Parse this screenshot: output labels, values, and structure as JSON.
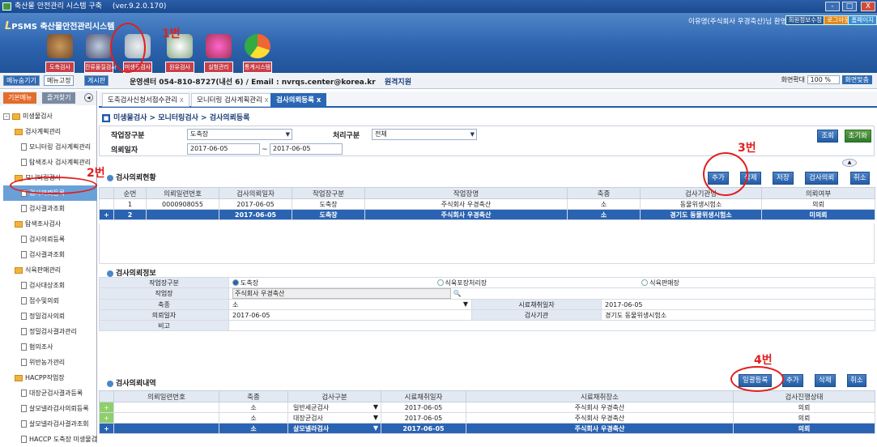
{
  "window": {
    "title": "축산물 안전관리 시스템 구축",
    "version": "(ver.9.2.0.170)",
    "min": "-",
    "max": "□",
    "close": "X"
  },
  "header": {
    "logo_prefix": "L",
    "logo_brand": "PSMS",
    "logo_text": "축산물안전관리시스템",
    "nav": [
      {
        "label": "도축검사"
      },
      {
        "label": "잔류물질검사"
      },
      {
        "label": "미생물검사"
      },
      {
        "label": "원유검사"
      },
      {
        "label": "실험관리"
      },
      {
        "label": "통계시스템"
      }
    ],
    "user_greeting": "이유명(주식회사 우경축산)님 환영합니다",
    "top_buttons": [
      "회원정보수정",
      "로그아웃",
      "홈페이지"
    ]
  },
  "toolbar": {
    "menu_toggle": "메뉴숨기기",
    "menu_fix": "메뉴고정",
    "board": "게시판",
    "contact": "운영센터 054-810-8727(내선 6) / Email : nvrqs.center@korea.kr",
    "remote": "원격지원",
    "zoom_label": "화면확대",
    "zoom_value": "100 %",
    "zoom_button": "화면맞춤"
  },
  "sidebar": {
    "tabs": [
      "기본메뉴",
      "즐겨찾기"
    ],
    "tree": [
      {
        "level": 1,
        "label": "미생물검사",
        "kind": "folder"
      },
      {
        "level": 2,
        "label": "검사계획관리",
        "kind": "folder"
      },
      {
        "level": 3,
        "label": "모니터링 검사계획관리",
        "kind": "doc"
      },
      {
        "level": 3,
        "label": "탐색조사 검사계획관리",
        "kind": "doc"
      },
      {
        "level": 2,
        "label": "모니터링검사",
        "kind": "folder"
      },
      {
        "level": 3,
        "label": "검사의뢰등록",
        "kind": "doc",
        "selected": true
      },
      {
        "level": 3,
        "label": "검사결과조회",
        "kind": "doc"
      },
      {
        "level": 2,
        "label": "탐색조사검사",
        "kind": "folder"
      },
      {
        "level": 3,
        "label": "검사의뢰등록",
        "kind": "doc"
      },
      {
        "level": 3,
        "label": "검사결과조회",
        "kind": "doc"
      },
      {
        "level": 2,
        "label": "식육판매관리",
        "kind": "folder"
      },
      {
        "level": 3,
        "label": "검사대상조회",
        "kind": "doc"
      },
      {
        "level": 3,
        "label": "접수및의뢰",
        "kind": "doc"
      },
      {
        "level": 3,
        "label": "정밀검사의뢰",
        "kind": "doc"
      },
      {
        "level": 3,
        "label": "정밀검사결과관리",
        "kind": "doc"
      },
      {
        "level": 3,
        "label": "혐의조사",
        "kind": "doc"
      },
      {
        "level": 3,
        "label": "위반농가관리",
        "kind": "doc"
      },
      {
        "level": 2,
        "label": "HACPP작업장",
        "kind": "folder"
      },
      {
        "level": 3,
        "label": "대장균검사결과등록",
        "kind": "doc"
      },
      {
        "level": 3,
        "label": "살모넬라검사의뢰등록",
        "kind": "doc"
      },
      {
        "level": 3,
        "label": "살모넬라검사결과조회",
        "kind": "doc"
      },
      {
        "level": 3,
        "label": "HACCP 도축장 미생물검",
        "kind": "doc"
      }
    ]
  },
  "tabs": [
    {
      "label": "도축검사신청서접수관리",
      "close": "x"
    },
    {
      "label": "모니터링 검사계획관리",
      "close": "x"
    },
    {
      "label": "검사의뢰등록",
      "close": "x",
      "active": true
    }
  ],
  "breadcrumb": "미생물검사 > 모니터링검사 > 검사의뢰등록",
  "search": {
    "work_type_label": "작업장구분",
    "work_type_value": "도축장",
    "process_label": "처리구분",
    "process_value": "전체",
    "request_date_label": "의뢰일자",
    "date_from": "2017-06-05",
    "date_sep": "~",
    "date_to": "2017-06-05",
    "query_button": "조회",
    "reset_button": "초기화",
    "collapse": "▲"
  },
  "request_status": {
    "title": "검사의뢰현황",
    "buttons": [
      "추가",
      "삭제",
      "저장",
      "검사의뢰",
      "취소"
    ],
    "columns": [
      "순번",
      "의뢰일련번호",
      "검사의뢰일자",
      "작업장구분",
      "작업장명",
      "축종",
      "검사기관명",
      "의뢰여부"
    ],
    "rows": [
      [
        "1",
        "0000908055",
        "2017-06-05",
        "도축장",
        "주식회사 우경축산",
        "소",
        "동물위생시험소",
        "의뢰"
      ],
      [
        "2",
        "",
        "2017-06-05",
        "도축장",
        "주식회사 우경축산",
        "소",
        "경기도 동물위생시험소",
        "미의뢰"
      ]
    ],
    "row_markers": [
      "",
      "+"
    ]
  },
  "request_info": {
    "title": "검사의뢰정보",
    "work_type_label": "작업장구분",
    "work_type_options": [
      "도축장",
      "식육포장처리장",
      "식육판매장"
    ],
    "workplace_label": "작업장",
    "workplace_value": "주식회사 우경축산",
    "species_label": "축종",
    "species_value": "소",
    "sample_date_label": "시료채취일자",
    "sample_date_value": "2017-06-05",
    "request_date_label": "의뢰일자",
    "request_date_value": "2017-06-05",
    "agency_label": "검사기관",
    "agency_value": "경기도 동물위생시험소",
    "note_label": "비고",
    "note_value": ""
  },
  "request_details": {
    "title": "검사의뢰내역",
    "buttons": [
      "일괄등록",
      "추가",
      "삭제",
      "취소"
    ],
    "columns": [
      "의뢰일련번호",
      "축종",
      "검사구분",
      "시료채취일자",
      "시료채취장소",
      "검사진행상태"
    ],
    "rows": [
      [
        "",
        "소",
        "일반세균검사",
        "2017-06-05",
        "주식회사 우경축산",
        "의뢰"
      ],
      [
        "",
        "소",
        "대장균검사",
        "2017-06-05",
        "주식회사 우경축산",
        "의뢰"
      ],
      [
        "",
        "소",
        "살모넬라검사",
        "2017-06-05",
        "주식회사 우경축산",
        "의뢰"
      ]
    ]
  },
  "annotations": {
    "a1": "1번",
    "a2": "2번",
    "a3": "3번",
    "a4": "4번"
  },
  "colors": {
    "accent": "#2a63b2",
    "annotation": "#e0201f",
    "nav_label": "#c8404a"
  }
}
